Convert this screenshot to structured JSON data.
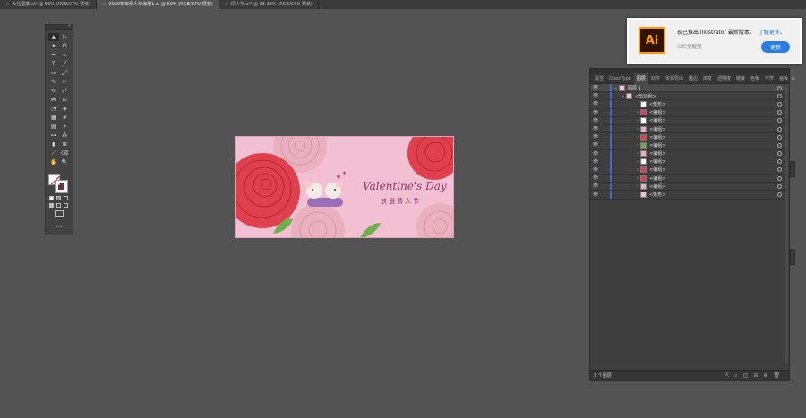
{
  "tabs": [
    {
      "label": "大社图案.ai* @ 50% (RGB/GPU 预览)",
      "active": false
    },
    {
      "label": "2020新年情人节海报1.ai @ 60% (RGB/GPU 预览)",
      "active": true
    },
    {
      "label": "情人节.ai* @ 33.33% (RGB/GPU 预览)",
      "active": false
    }
  ],
  "notification": {
    "app_icon": "Ai",
    "message": "现已推出 Illustrator 最新版本。",
    "learn_more": "了解更多。",
    "remind_later": "以后提醒我",
    "update_button": "更新"
  },
  "artwork": {
    "title": "Valentine's Day",
    "subtitle": "浪漫情人节",
    "colors": {
      "background": "#f2bfd3",
      "rose_red": "#e0404d",
      "rose_pink": "#eab0bf",
      "leaf": "#6fae4a"
    }
  },
  "layers_panel": {
    "tabs": [
      "属性",
      "OpenType",
      "图层",
      "动作",
      "资源导出",
      "描边",
      "渐变",
      "透明度",
      "链接",
      "色板",
      "字符",
      "画板"
    ],
    "active_tab": "图层",
    "top_layer": "图层 1",
    "group": "<剪切组>",
    "items": [
      "<矩形>",
      "<编组>",
      "<编组>",
      "<编组>",
      "<编组>",
      "<编组>",
      "<编组>",
      "<编组>",
      "<编组>",
      "<编组>",
      "<编组>",
      "<矩形>"
    ],
    "footer": "1 个图层"
  },
  "toolbar": {
    "more": "..."
  }
}
